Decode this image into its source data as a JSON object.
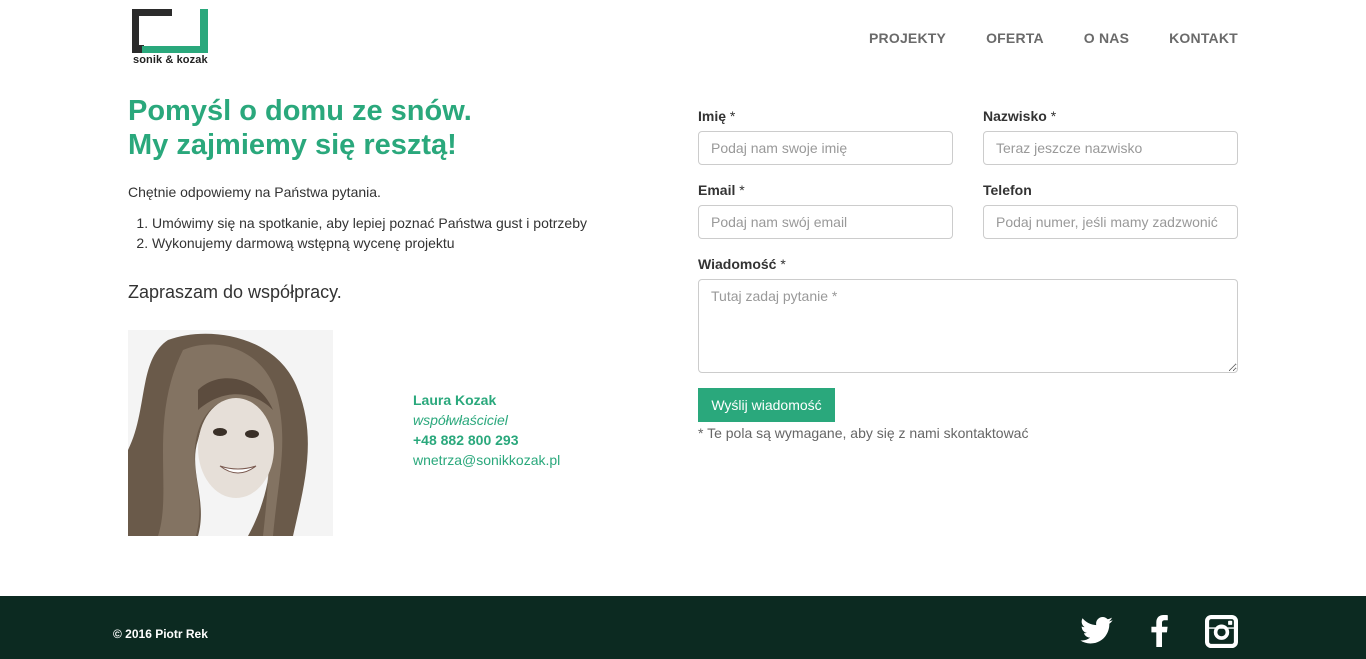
{
  "header": {
    "logo_text": "sonik & kozak",
    "nav": [
      "PROJEKTY",
      "OFERTA",
      "O NAS",
      "KONTAKT"
    ]
  },
  "intro": {
    "headline_line1": "Pomyśl o domu ze snów.",
    "headline_line2": "My zajmiemy się resztą!",
    "lead": "Chętnie odpowiemy na Państwa pytania.",
    "steps": [
      "Umówimy się na spotkanie, aby lepiej poznać Państwa gust i potrzeby",
      "Wykonujemy darmową wstępną wycenę projektu"
    ],
    "invite": "Zapraszam do współpracy."
  },
  "contact_person": {
    "name": "Laura Kozak",
    "role": "współwłaściciel",
    "phone": "+48 882 800 293",
    "email": "wnetrza@sonikkozak.pl"
  },
  "form": {
    "first_name": {
      "label": "Imię",
      "required": "*",
      "placeholder": "Podaj nam swoje imię"
    },
    "last_name": {
      "label": "Nazwisko",
      "required": "*",
      "placeholder": "Teraz jeszcze nazwisko"
    },
    "email": {
      "label": "Email",
      "required": "*",
      "placeholder": "Podaj nam swój email"
    },
    "phone": {
      "label": "Telefon",
      "placeholder": "Podaj numer, jeśli mamy zadzwonić"
    },
    "message": {
      "label": "Wiadomość",
      "required": "*",
      "placeholder": "Tutaj zadaj pytanie *"
    },
    "submit_label": "Wyślij wiadomość",
    "required_note": "* Te pola są wymagane, aby się z nami skontaktować"
  },
  "footer": {
    "copyright": "© 2016 Piotr Rek",
    "social": [
      "twitter-icon",
      "facebook-icon",
      "instagram-icon"
    ]
  },
  "colors": {
    "accent": "#2aa87c",
    "footer_bg": "#0c2a21",
    "nav_text": "#6a6a6a"
  }
}
